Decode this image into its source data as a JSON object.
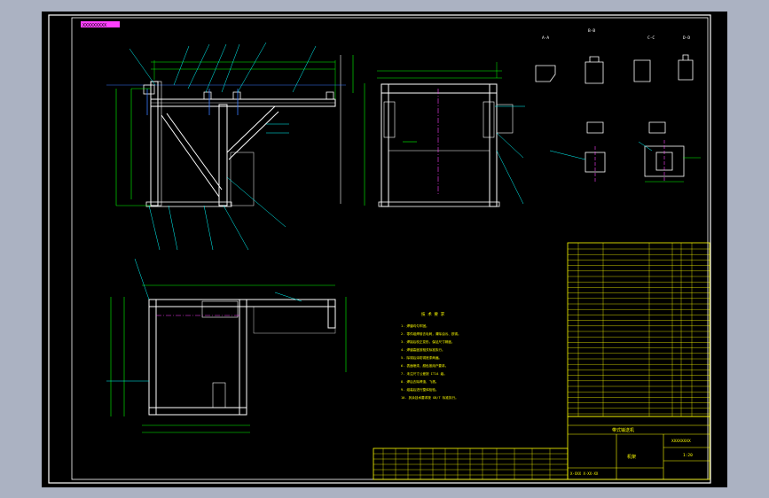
{
  "drawing": {
    "top_label": "XXXXXXXXX",
    "notes_title": "技 术 要 求",
    "notes": [
      "1. 焊缝均匀牢固。",
      "2. 零件组焊前去毛刺，清除油污、铁锈。",
      "3. 焊接后校正变形，保证尺寸精度。",
      "4. 焊缝高度按相关标准执行。",
      "5. 除锈后涂防锈底漆两遍。",
      "6. 表面喷漆，颜色按用户要求。",
      "7. 未注尺寸公差按 IT14 级。",
      "8. 焊后去除焊渣、飞溅。",
      "9. 组装后进行整体检验。",
      "10. 其余技术要求按 GB/T 标准执行。"
    ],
    "title_block": {
      "subtitle": "带式输送机",
      "part_name": "机架",
      "code": "XXXXXXXX",
      "scale": "1:20",
      "footer": "X-XXX X-XX-XX"
    },
    "section_labels": [
      "A-A",
      "B-B",
      "C-C",
      "D-D"
    ],
    "colors": {
      "frame": "#ffffff",
      "dim": "#00ff00",
      "leader": "#00ffff",
      "center": "#ff00ff",
      "table": "#ffff00",
      "note": "#ffff00",
      "magenta": "#ff40ff",
      "blue": "#3a7bff"
    }
  }
}
